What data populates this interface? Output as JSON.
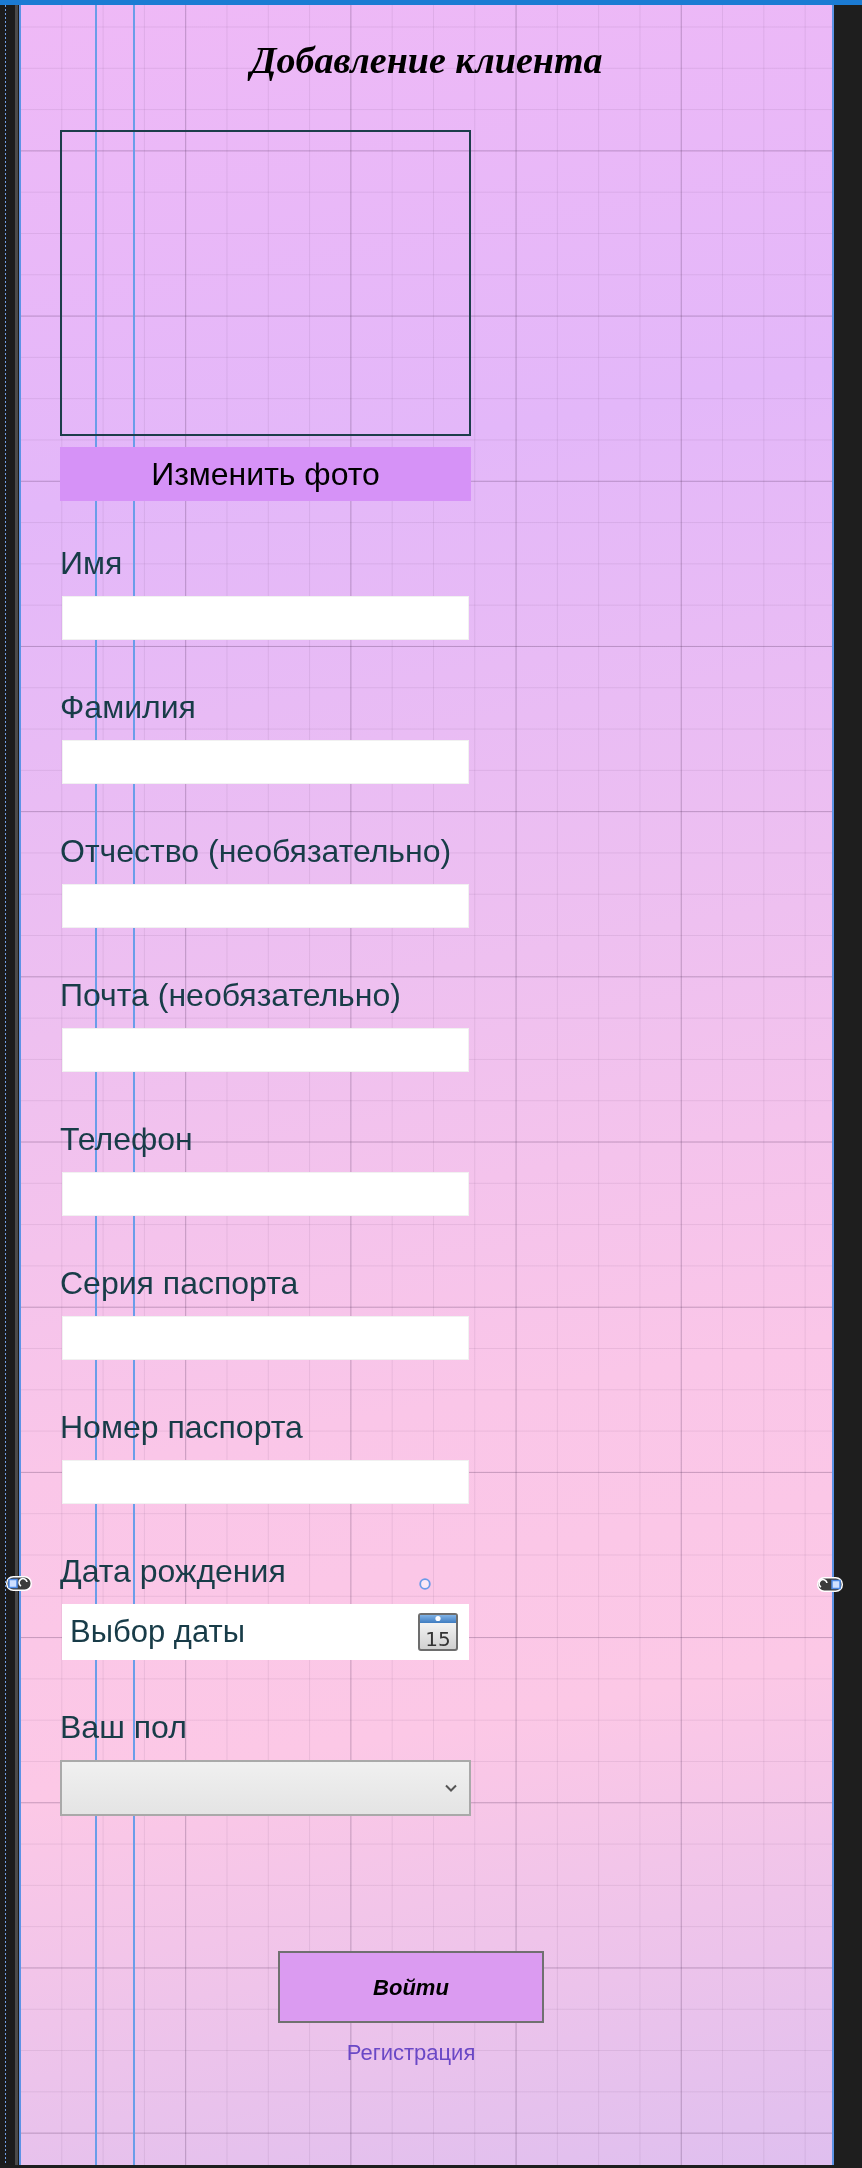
{
  "title": "Добавление клиента",
  "photo": {
    "button": "Изменить фото"
  },
  "fields": [
    {
      "kind": "text",
      "label": "Имя"
    },
    {
      "kind": "text",
      "label": "Фамилия"
    },
    {
      "kind": "text",
      "label": "Отчество (необязательно)"
    },
    {
      "kind": "text",
      "label": "Почта (необязательно)"
    },
    {
      "kind": "text",
      "label": "Телефон"
    },
    {
      "kind": "text",
      "label": "Серия паспорта"
    },
    {
      "kind": "text",
      "label": "Номер паспорта"
    },
    {
      "kind": "date",
      "label": "Дата рождения",
      "placeholder": "Выбор даты",
      "icon_text": "15"
    },
    {
      "kind": "select",
      "label": "Ваш пол"
    }
  ],
  "actions": {
    "submit": "Войти",
    "link": "Регистрация"
  }
}
